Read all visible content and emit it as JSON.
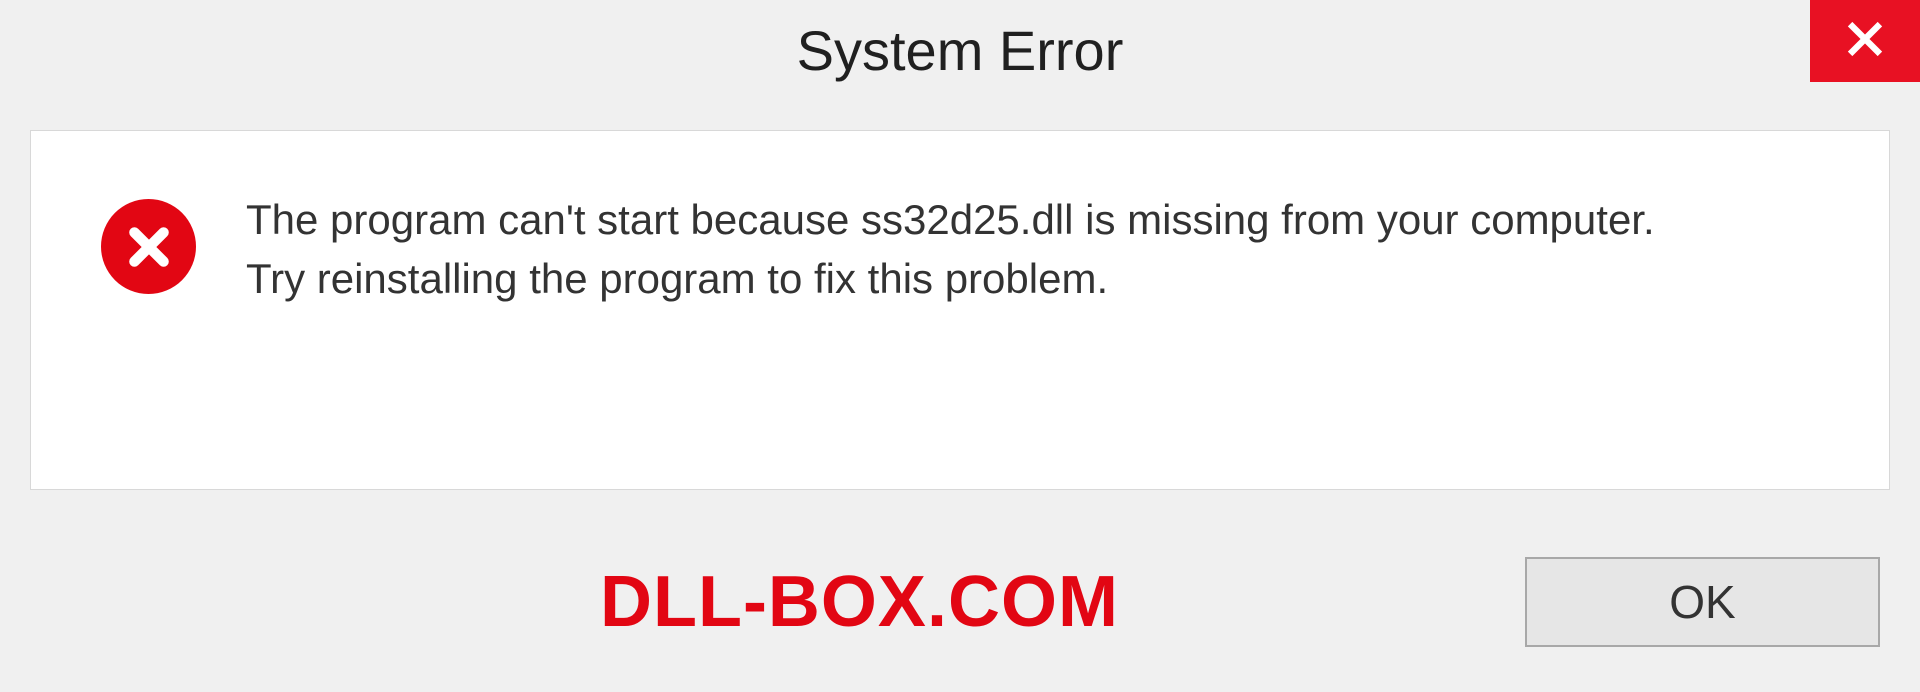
{
  "titlebar": {
    "title": "System Error"
  },
  "message": {
    "text": "The program can't start because ss32d25.dll is missing from your computer.\nTry reinstalling the program to fix this problem."
  },
  "footer": {
    "watermark": "DLL-BOX.COM",
    "ok_label": "OK"
  },
  "colors": {
    "close_bg": "#e81123",
    "error_red": "#e20613"
  }
}
